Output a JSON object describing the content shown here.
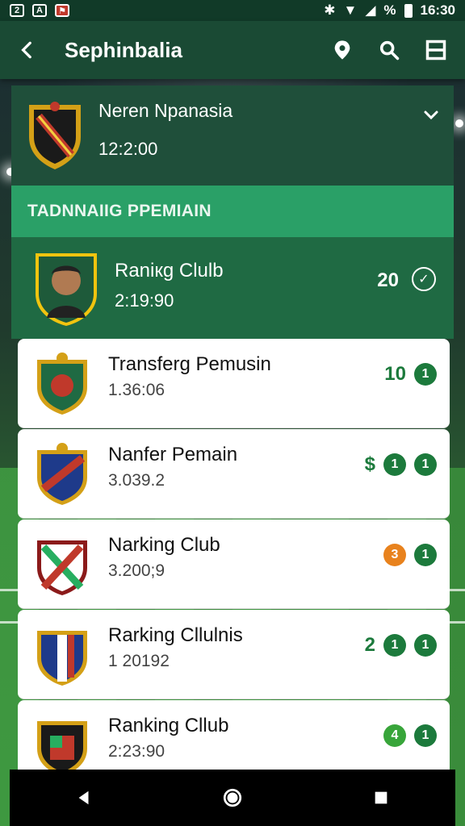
{
  "status_bar": {
    "time": "16:30",
    "battery": "%"
  },
  "app_bar": {
    "title": "Sephinbalia"
  },
  "match": {
    "name": "Neren Npanasia",
    "time": "12:2:00"
  },
  "section": {
    "title": "TADNNAIIG PPEMIAIN"
  },
  "featured": {
    "name": "Raniкg Clulb",
    "time": "2:19:90",
    "score": "20",
    "check": "✓"
  },
  "items": [
    {
      "name": "Transferg Pemusin",
      "sub": "1.36:06",
      "value": "10",
      "value_color": "#1c7a3c",
      "badge": "1",
      "badge_color": "#1c7a3c"
    },
    {
      "name": "Nanfer Pemain",
      "sub": "3.039.2",
      "value": "$",
      "value_color": "#1c7a3c",
      "badge": "1",
      "badge_color": "#1c7a3c"
    },
    {
      "name": "Narking Club",
      "sub": "3.200;9",
      "value": "3",
      "value_color": "#e8821d",
      "badge": "1",
      "badge_color": "#1c7a3c"
    },
    {
      "name": "Rarking Cllulnis",
      "sub": "1 20192",
      "value": "2",
      "value_color": "#1c7a3c",
      "badge": "1",
      "badge_color": "#1c7a3c"
    },
    {
      "name": "Ranking Cllub",
      "sub": "2:23:90",
      "value": "4",
      "value_color": "#38a53a",
      "badge": "1",
      "badge_color": "#1c7a3c"
    }
  ],
  "colors": {
    "primary": "#1a4a34",
    "accent": "#2aa067",
    "featured": "#1f6a43"
  }
}
